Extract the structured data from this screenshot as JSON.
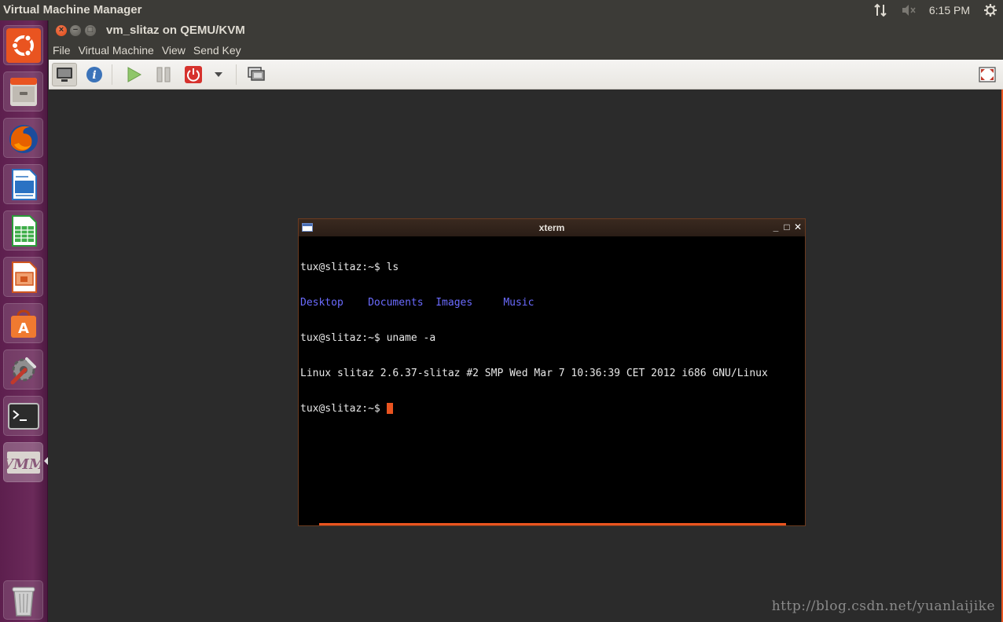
{
  "top_panel": {
    "app_title": "Virtual Machine Manager",
    "clock": "6:15 PM",
    "icons": [
      "network-icon",
      "volume-muted-icon",
      "gear-icon"
    ]
  },
  "launcher": {
    "items": [
      {
        "name": "ubuntu-dash",
        "color": "#dd4814"
      },
      {
        "name": "files",
        "color": "#9a9a9a"
      },
      {
        "name": "firefox",
        "color": "#e66000"
      },
      {
        "name": "libreoffice-writer",
        "color": "#2a72c3"
      },
      {
        "name": "libreoffice-calc",
        "color": "#2b9b3a"
      },
      {
        "name": "libreoffice-impress",
        "color": "#d0561f"
      },
      {
        "name": "ubuntu-software-center",
        "color": "#e8722a"
      },
      {
        "name": "system-settings",
        "color": "#7a7a7a"
      },
      {
        "name": "terminal",
        "color": "#333333"
      },
      {
        "name": "virt-manager",
        "color": "#8a8a8a"
      },
      {
        "name": "trash",
        "color": "#9a9a9a"
      }
    ]
  },
  "vm_window": {
    "title": "vm_slitaz on QEMU/KVM",
    "menu": [
      "File",
      "Virtual Machine",
      "View",
      "Send Key"
    ],
    "accent": "#e95420"
  },
  "xterm": {
    "title": "xterm",
    "controls": [
      "_",
      "□",
      "✕"
    ],
    "lines": [
      {
        "prompt": "tux@slitaz:~$ ",
        "text": "ls"
      },
      {
        "dirs": [
          "Desktop",
          "Documents",
          "Images",
          "Music"
        ]
      },
      {
        "prompt": "tux@slitaz:~$ ",
        "text": "uname -a"
      },
      {
        "text": "Linux slitaz 2.6.37-slitaz #2 SMP Wed Mar 7 10:36:39 CET 2012 i686 GNU/Linux"
      },
      {
        "prompt": "tux@slitaz:~$ ",
        "text": ""
      }
    ],
    "dir_color": "#6b6bff",
    "cursor_color": "#e95420"
  },
  "watermark": "http://blog.csdn.net/yuanlaijike"
}
